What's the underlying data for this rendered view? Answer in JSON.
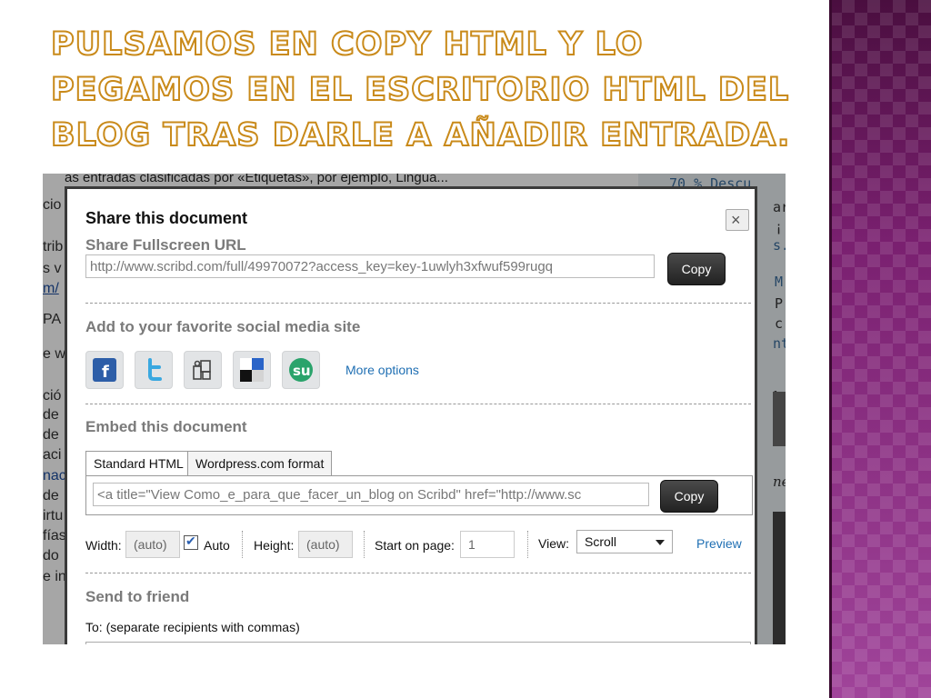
{
  "slide": {
    "title": "Pulsamos en copy html y lo pegamos en el escritorio HTML del blog tras darle a añadir entrada."
  },
  "background": {
    "top_text": "as entradas clasificadas por «Etiquetas», por ejemplo, Lingua...",
    "left_fragments": [
      "cio",
      "trib",
      "s v",
      "m/",
      "PA",
      "e w",
      "ció",
      "de",
      "de",
      "aci",
      "nac",
      "de",
      "irtu",
      "fías",
      "do",
      "e in"
    ],
    "right_fragments": [
      "70 % Descu",
      "ar",
      "¡",
      "s.",
      "M",
      "P",
      "c",
      "nt",
      "be",
      "ne"
    ]
  },
  "dialog": {
    "title": "Share this document",
    "close_glyph": "×",
    "fullscreen": {
      "heading": "Share Fullscreen URL",
      "url": "http://www.scribd.com/full/49970072?access_key=key-1uwlyh3xfwuf599rugq",
      "copy_label": "Copy"
    },
    "social": {
      "heading": "Add to your favorite social media site",
      "icons": [
        "facebook-icon",
        "twitter-icon",
        "myspace-icon",
        "delicious-icon",
        "stumbleupon-icon"
      ],
      "more_label": "More options"
    },
    "embed": {
      "heading": "Embed this document",
      "tabs": [
        "Standard HTML",
        "Wordpress.com format"
      ],
      "code": "<a title=\"View Como_e_para_que_facer_un_blog on Scribd\" href=\"http://www.sc",
      "copy_label": "Copy",
      "width_label": "Width:",
      "width_value": "(auto)",
      "auto_label": "Auto",
      "height_label": "Height:",
      "height_value": "(auto)",
      "start_label": "Start on page:",
      "start_value": "1",
      "view_label": "View:",
      "view_value": "Scroll",
      "preview_label": "Preview"
    },
    "send": {
      "heading": "Send to friend",
      "to_label": "To: (separate recipients with commas)"
    }
  },
  "colors": {
    "title_outline": "#c98a1a",
    "panel": "#8a2a7c",
    "link": "#1f6fb3",
    "copy_button": "#2b2b2b"
  }
}
